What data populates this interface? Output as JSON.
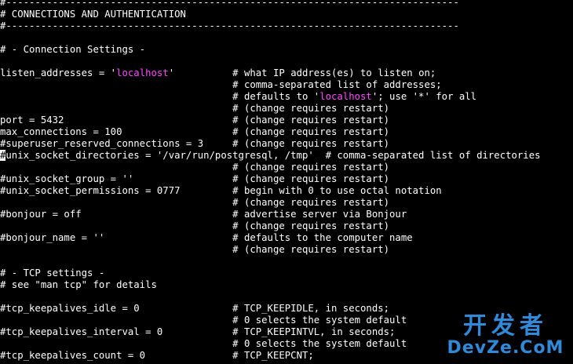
{
  "editor": {
    "lines": [
      [
        {
          "t": "#------------------------------------------------------------------------------"
        }
      ],
      [
        {
          "t": "# CONNECTIONS AND AUTHENTICATION"
        }
      ],
      [
        {
          "t": "#------------------------------------------------------------------------------"
        }
      ],
      [],
      [
        {
          "t": "# - Connection Settings -"
        }
      ],
      [],
      [
        {
          "t": "listen_addresses = '"
        },
        {
          "t": "localhost",
          "c": "pink"
        },
        {
          "t": "'          # what IP address(es) to listen on;"
        }
      ],
      [
        {
          "t": "                                        # comma-separated list of addresses;"
        }
      ],
      [
        {
          "t": "                                        # defaults to '"
        },
        {
          "t": "localhost",
          "c": "pink"
        },
        {
          "t": "'; use '*' for all"
        }
      ],
      [
        {
          "t": "                                        # (change requires restart)"
        }
      ],
      [
        {
          "t": "port = 5432                             # (change requires restart)"
        }
      ],
      [
        {
          "t": "max_connections = 100                   # (change requires restart)"
        }
      ],
      [
        {
          "t": "#superuser_reserved_connections = 3     # (change requires restart)"
        }
      ],
      [
        {
          "t": "#",
          "c": "cursor"
        },
        {
          "t": "unix_socket_directories = '/var/run/postgresql, /tmp'  # comma-separated list of directories"
        }
      ],
      [
        {
          "t": "                                        # (change requires restart)"
        }
      ],
      [
        {
          "t": "#unix_socket_group = ''                 # (change requires restart)"
        }
      ],
      [
        {
          "t": "#unix_socket_permissions = 0777         # begin with 0 to use octal notation"
        }
      ],
      [
        {
          "t": "                                        # (change requires restart)"
        }
      ],
      [
        {
          "t": "#bonjour = off                          # advertise server via Bonjour"
        }
      ],
      [
        {
          "t": "                                        # (change requires restart)"
        }
      ],
      [
        {
          "t": "#bonjour_name = ''                      # defaults to the computer name"
        }
      ],
      [
        {
          "t": "                                        # (change requires restart)"
        }
      ],
      [],
      [
        {
          "t": "# - TCP settings -"
        }
      ],
      [
        {
          "t": "# see \"man tcp\" for details"
        }
      ],
      [],
      [
        {
          "t": "#tcp_keepalives_idle = 0                # TCP_KEEPIDLE, in seconds;"
        }
      ],
      [
        {
          "t": "                                        # 0 selects the system default"
        }
      ],
      [
        {
          "t": "#tcp_keepalives_interval = 0            # TCP_KEEPINTVL, in seconds;"
        }
      ],
      [
        {
          "t": "                                        # 0 selects the system default"
        }
      ],
      [
        {
          "t": "#tcp_keepalives_count = 0               # TCP_KEEPCNT;"
        }
      ]
    ]
  },
  "watermark": {
    "top": "开发者",
    "bottom": "DevZe.CoM",
    "color": "#3aa3ff"
  },
  "colors": {
    "background": "#000000",
    "text": "#ffffff",
    "string_highlight": "#ff4bff"
  }
}
